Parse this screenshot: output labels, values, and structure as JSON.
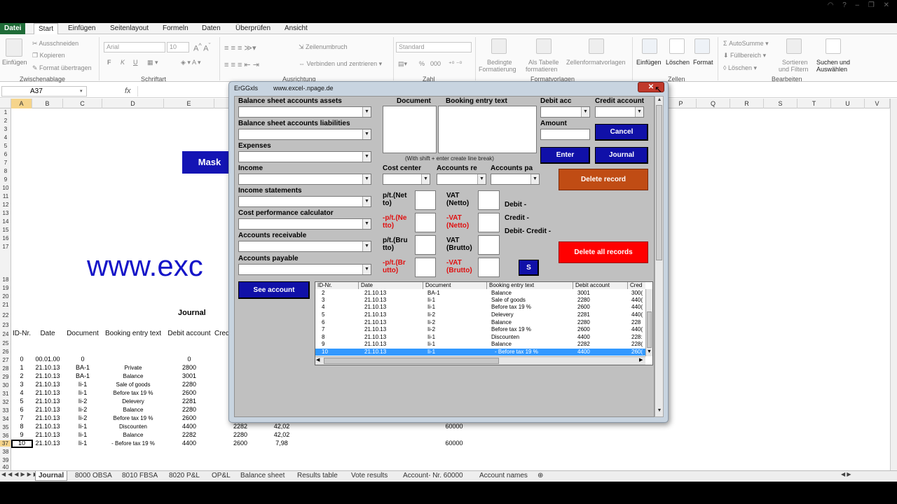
{
  "ribbon": {
    "tabs": [
      "Datei",
      "Start",
      "Einfügen",
      "Seitenlayout",
      "Formeln",
      "Daten",
      "Überprüfen",
      "Ansicht"
    ],
    "clipboard": {
      "paste": "Einfügen",
      "cut": "Ausschneiden",
      "copy": "Kopieren",
      "format_painter": "Format übertragen",
      "group": "Zwischenablage"
    },
    "font": {
      "name": "Arial",
      "size": "10",
      "bold": "F",
      "italic": "K",
      "underline": "U",
      "group": "Schriftart"
    },
    "alignment": {
      "wrap": "Zeilenumbruch",
      "merge": "Verbinden und zentrieren",
      "group": "Ausrichtung"
    },
    "number": {
      "format": "Standard",
      "percent": "%",
      "thousands": "000",
      "group": "Zahl"
    },
    "styles": {
      "conditional_1": "Bedingte",
      "conditional_2": "Formatierung",
      "as_table_1": "Als Tabelle",
      "as_table_2": "formatieren",
      "cell_styles": "Zellenformatvorlagen",
      "group": "Formatvorlagen"
    },
    "cells": {
      "insert": "Einfügen",
      "delete": "Löschen",
      "format": "Format",
      "group": "Zellen"
    },
    "editing": {
      "autosum": "AutoSumme",
      "fill": "Füllbereich",
      "clear": "Löschen",
      "sort_1": "Sortieren",
      "sort_2": "und Filtern",
      "find_1": "Suchen und",
      "find_2": "Auswählen",
      "group": "Bearbeiten"
    }
  },
  "formula_bar": {
    "name_box": "A37",
    "fx": "fx"
  },
  "columns": [
    "A",
    "B",
    "C",
    "D",
    "E",
    "P",
    "Q",
    "R",
    "S",
    "T",
    "U",
    "V"
  ],
  "rows": [
    "1",
    "2",
    "3",
    "4",
    "5",
    "6",
    "7",
    "8",
    "9",
    "10",
    "11",
    "12",
    "13",
    "14",
    "15",
    "16",
    "17",
    "18",
    "19",
    "20",
    "21",
    "22",
    "23",
    "24",
    "25",
    "26",
    "27",
    "28",
    "29",
    "30",
    "31",
    "32",
    "33",
    "34",
    "35",
    "36",
    "37",
    "38",
    "39",
    "40"
  ],
  "sheet": {
    "mask_button": "Mask",
    "url_text": "www.exc",
    "journal_title": "Journal",
    "headers": [
      "ID-Nr.",
      "Date",
      "Document",
      "Booking entry text",
      "Debit account",
      "Cred"
    ],
    "rows": [
      [
        "0",
        "00.01.00",
        "0",
        "",
        "0",
        "",
        "",
        ""
      ],
      [
        "1",
        "21.10.13",
        "BA-1",
        "Private",
        "2800",
        "",
        "",
        ""
      ],
      [
        "2",
        "21.10.13",
        "BA-1",
        "Balance",
        "3001",
        "",
        "",
        ""
      ],
      [
        "3",
        "21.10.13",
        "Ii-1",
        "Sale of goods",
        "2280",
        "",
        "",
        ""
      ],
      [
        "4",
        "21.10.13",
        "Ii-1",
        "Before tax 19 %",
        "2600",
        "",
        "",
        ""
      ],
      [
        "5",
        "21.10.13",
        "Ii-2",
        "Delevery",
        "2281",
        "",
        "",
        ""
      ],
      [
        "6",
        "21.10.13",
        "Ii-2",
        "Balance",
        "2280",
        "",
        "",
        ""
      ],
      [
        "7",
        "21.10.13",
        "Ii-2",
        "Before tax 19 %",
        "2600",
        "",
        "",
        ""
      ],
      [
        "8",
        "21.10.13",
        "Ii-1",
        "Discounten",
        "4400",
        "2282",
        "42,02",
        "60000"
      ],
      [
        "9",
        "21.10.13",
        "Ii-1",
        "Balance",
        "2282",
        "2280",
        "42,02",
        ""
      ],
      [
        "10",
        "21.10.13",
        "Ii-1",
        "- Before tax 19 %",
        "4400",
        "2600",
        "7,98",
        "60000"
      ]
    ]
  },
  "sheet_tabs": [
    "Journal",
    "8000 OBSA",
    "8010 FBSA",
    "8020 P&L",
    "OP&L",
    "Balance sheet",
    "Results table",
    "Vote results",
    "Account- Nr. 60000",
    "Account names"
  ],
  "dialog": {
    "title": "ErGGxls",
    "title_url": "www.excel-.npage.de",
    "close": "✕",
    "labels": {
      "bs_assets": "Balance sheet accounts assets",
      "bs_liabilities": "Balance sheet accounts liabilities",
      "expenses": "Expenses",
      "income": "Income",
      "income_statements": "Income statements",
      "cost_perf": "Cost performance calculator",
      "acc_receivable": "Accounts receivable",
      "acc_payable": "Accounts payable",
      "document": "Document",
      "booking_text": "Booking entry text",
      "debit_acc": "Debit acc",
      "credit_account": "Credit account",
      "amount": "Amount",
      "note": "(With shift + enter create line break)",
      "cost_center": "Cost center",
      "accounts_re": "Accounts re",
      "accounts_pa": "Accounts pa",
      "pt_net_1": "p/t.(Net",
      "pt_net_2": "to)",
      "vat_net_1": "VAT",
      "vat_net_2": "(Netto)",
      "mpt_net_1": "-p/t.(Ne",
      "mpt_net_2": "tto)",
      "mvat_net_1": "-VAT",
      "mvat_net_2": "(Netto)",
      "pt_gross_1": "p/t.(Bru",
      "pt_gross_2": "tto)",
      "vat_gross_1": "VAT",
      "vat_gross_2": "(Brutto)",
      "mpt_gross_1": "-p/t.(Br",
      "mpt_gross_2": "utto)",
      "mvat_gross_1": "-VAT",
      "mvat_gross_2": "(Brutto)",
      "debit": "Debit  -",
      "credit": "Credit  -",
      "debit_credit": "Debit-  Credit  -"
    },
    "buttons": {
      "cancel": "Cancel",
      "enter": "Enter",
      "journal": "Journal",
      "delete_record": "Delete record",
      "delete_all": "Delete all records",
      "s": "S",
      "see_account": "See account"
    },
    "list": {
      "columns": [
        "ID-Nr.",
        "Date",
        "Document",
        "Booking entry text",
        "Debit account",
        "Cred"
      ],
      "rows": [
        [
          "2",
          "21.10.13",
          "BA-1",
          "Balance",
          "3001",
          "300("
        ],
        [
          "3",
          "21.10.13",
          "Ii-1",
          "Sale of goods",
          "2280",
          "440("
        ],
        [
          "4",
          "21.10.13",
          "Ii-1",
          "Before tax 19 %",
          "2600",
          "440("
        ],
        [
          "5",
          "21.10.13",
          "Ii-2",
          "Delevery",
          "2281",
          "440("
        ],
        [
          "6",
          "21.10.13",
          "Ii-2",
          "Balance",
          "2280",
          "228"
        ],
        [
          "7",
          "21.10.13",
          "Ii-2",
          "Before tax 19 %",
          "2600",
          "440("
        ],
        [
          "8",
          "21.10.13",
          "Ii-1",
          "Discounten",
          "4400",
          "228:"
        ],
        [
          "9",
          "21.10.13",
          "Ii-1",
          "Balance",
          "2282",
          "228("
        ],
        [
          "10",
          "21.10.13",
          "Ii-1",
          "- Before tax 19 %",
          "4400",
          "260("
        ]
      ],
      "selected_index": 8
    }
  }
}
